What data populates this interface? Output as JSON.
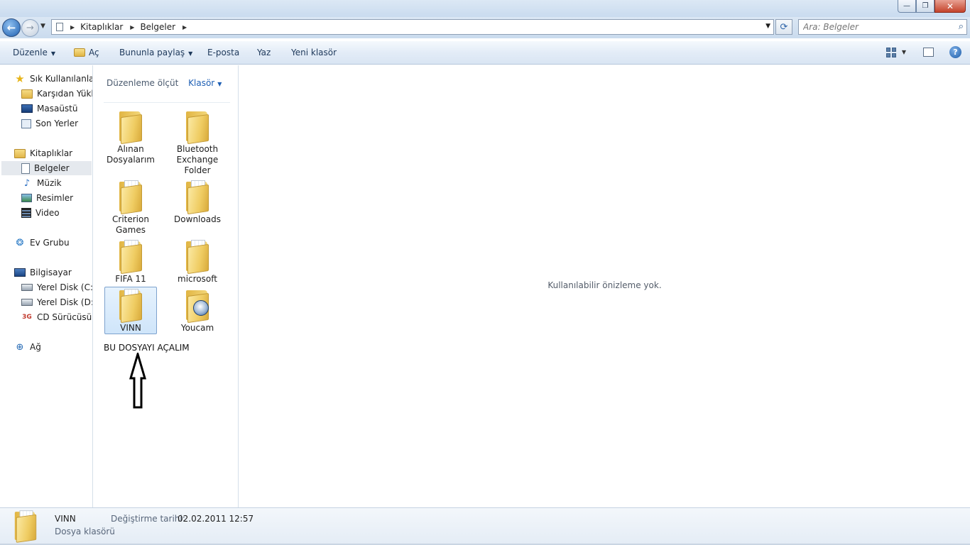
{
  "window": {
    "buttons": {
      "minimize": "—",
      "restore": "❐",
      "close": "✕"
    }
  },
  "navigation": {
    "back_glyph": "←",
    "forward_glyph": "→",
    "breadcrumb": [
      "Kitaplıklar",
      "Belgeler"
    ],
    "refresh_glyph": "⟳",
    "search_placeholder": "Ara: Belgeler"
  },
  "toolbar": {
    "organize": "Düzenle",
    "open": "Aç",
    "share": "Bununla paylaş",
    "email": "E-posta",
    "print": "Yaz",
    "new_folder": "Yeni klasör",
    "help": "?"
  },
  "sidebar": {
    "favorites": {
      "label": "Sık Kullanılanlar",
      "items": [
        "Karşıdan Yüklenenler",
        "Masaüstü",
        "Son Yerler"
      ]
    },
    "libraries": {
      "label": "Kitaplıklar",
      "items": [
        "Belgeler",
        "Müzik",
        "Resimler",
        "Video"
      ],
      "selected": "Belgeler"
    },
    "homegroup": "Ev Grubu",
    "computer": {
      "label": "Bilgisayar",
      "items": [
        "Yerel Disk (C:)",
        "Yerel Disk (D:)",
        "CD Sürücüsü (F:)"
      ]
    },
    "network": "Ağ"
  },
  "filelist": {
    "arrange_label": "Düzenleme ölçüt",
    "arrange_value": "Klasör",
    "items": [
      {
        "name_lines": [
          "Alınan",
          "Dosyalarım"
        ],
        "icon": "folder-icon"
      },
      {
        "name_lines": [
          "Bluetooth",
          "Exchange",
          "Folder"
        ],
        "icon": "folder-icon"
      },
      {
        "name_lines": [
          "Criterion",
          "Games"
        ],
        "icon": "folder-with-files-icon"
      },
      {
        "name_lines": [
          "Downloads"
        ],
        "icon": "folder-with-files-icon"
      },
      {
        "name_lines": [
          "FIFA 11"
        ],
        "icon": "folder-with-files-icon"
      },
      {
        "name_lines": [
          "microsoft"
        ],
        "icon": "folder-with-files-icon"
      },
      {
        "name_lines": [
          "VINN"
        ],
        "icon": "folder-with-files-icon",
        "selected": true
      },
      {
        "name_lines": [
          "Youcam"
        ],
        "icon": "folder-with-badge-icon"
      }
    ],
    "annotation": "BU DOSYAYI AÇALIM"
  },
  "preview": {
    "message": "Kullanılabilir önizleme yok."
  },
  "details": {
    "name": "VINN",
    "type": "Dosya klasörü",
    "modified_label": "Değiştirme tarihi:",
    "modified_value": "02.02.2011 12:57"
  }
}
